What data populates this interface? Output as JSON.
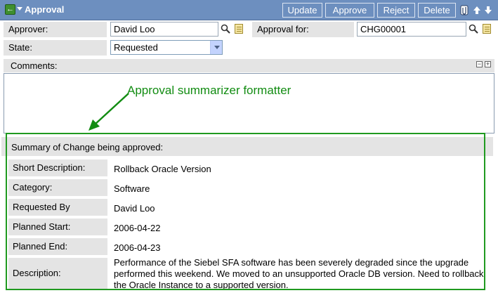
{
  "header": {
    "title": "Approval",
    "buttons": {
      "update": "Update",
      "approve": "Approve",
      "reject": "Reject",
      "delete": "Delete"
    },
    "icons": [
      "back-icon",
      "menu-caret-icon",
      "attachment-icon",
      "arrow-up-icon",
      "arrow-down-icon"
    ]
  },
  "form": {
    "approver_label": "Approver:",
    "approver_value": "David Loo",
    "approval_for_label": "Approval for:",
    "approval_for_value": "CHG00001",
    "state_label": "State:",
    "state_value": "Requested"
  },
  "comments": {
    "label": "Comments:"
  },
  "annotation": {
    "text": "Approval summarizer formatter"
  },
  "summary": {
    "heading": "Summary of Change being approved:",
    "rows": [
      {
        "label": "Short Description:",
        "value": "Rollback Oracle Version"
      },
      {
        "label": "Category:",
        "value": "Software"
      },
      {
        "label": "Requested By",
        "value": "David Loo"
      },
      {
        "label": "Planned Start:",
        "value": "2006-04-22"
      },
      {
        "label": "Planned End:",
        "value": "2006-04-23"
      },
      {
        "label": "Description:",
        "value": "Performance of the Siebel SFA software has been severely degraded since the upgrade performed this weekend. We moved to an unsupported Oracle DB version. Need to rollback the Oracle Instance to a supported version."
      }
    ]
  },
  "colors": {
    "header_bg": "#6d8fbf",
    "label_bg": "#e4e4e4",
    "annotation_green": "#128c12"
  }
}
